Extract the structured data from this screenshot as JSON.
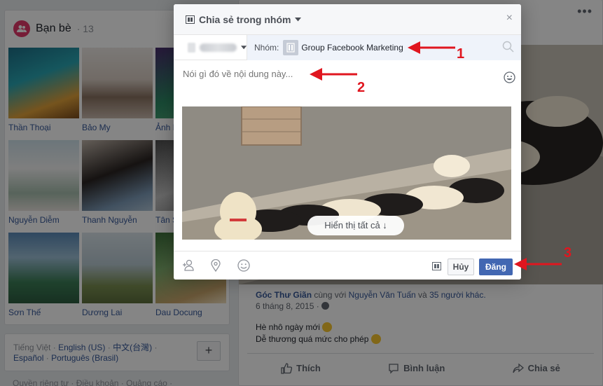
{
  "colors": {
    "accent": "#4267b2",
    "link": "#365899",
    "annotation": "#e0161f",
    "friends_icon": "#e2396a"
  },
  "friends": {
    "title": "Bạn bè",
    "count": "· 13",
    "items": [
      {
        "name": "Thần Thoại"
      },
      {
        "name": "Bảo My"
      },
      {
        "name": "Ảnh I"
      },
      {
        "name": "Nguyễn Diễm"
      },
      {
        "name": "Thanh Nguyễn"
      },
      {
        "name": "Tân S"
      },
      {
        "name": "Sơn Thế"
      },
      {
        "name": "Dương Lai"
      },
      {
        "name": "Dau Docung"
      }
    ]
  },
  "languages": {
    "current": "Tiếng Việt",
    "sep": "·",
    "line1": [
      "English (US)",
      "中文(台灣)"
    ],
    "line2": [
      "Español",
      "Português (Brasil)"
    ],
    "add": "+"
  },
  "footer": {
    "text": "Quyền riêng tư · Điều khoản · Quảng cáo ·"
  },
  "post": {
    "author": "Góc Thư Giãn",
    "with_text": "cùng với",
    "tagged": "Nguyễn Văn Tuấn",
    "and_text": "và",
    "others": "35 người khác.",
    "date": "6 tháng 8, 2015 ·",
    "line1": "Hè nhô ngày mới",
    "line2": "Dễ thương quá mức cho phép",
    "actions": {
      "like": "Thích",
      "comment": "Bình luận",
      "share": "Chia sẻ"
    },
    "more": "•••"
  },
  "dialog": {
    "title": "Chia sẻ trong nhóm",
    "close": "×",
    "group_label": "Nhóm:",
    "group_name": "Group Facebook Marketing",
    "composer_placeholder": "Nói gì đó về nội dung này...",
    "show_all": "Hiển thị tất cả ↓",
    "cancel": "Hủy",
    "post": "Đăng"
  },
  "annotations": {
    "one": "1",
    "two": "2",
    "three": "3"
  },
  "icons": [
    "group-icon",
    "caret-down-icon",
    "close-icon",
    "search-icon",
    "emoji-icon",
    "tag-friend-icon",
    "location-icon",
    "feeling-icon",
    "audience-icon",
    "like-icon",
    "comment-icon",
    "share-icon",
    "globe-icon"
  ]
}
